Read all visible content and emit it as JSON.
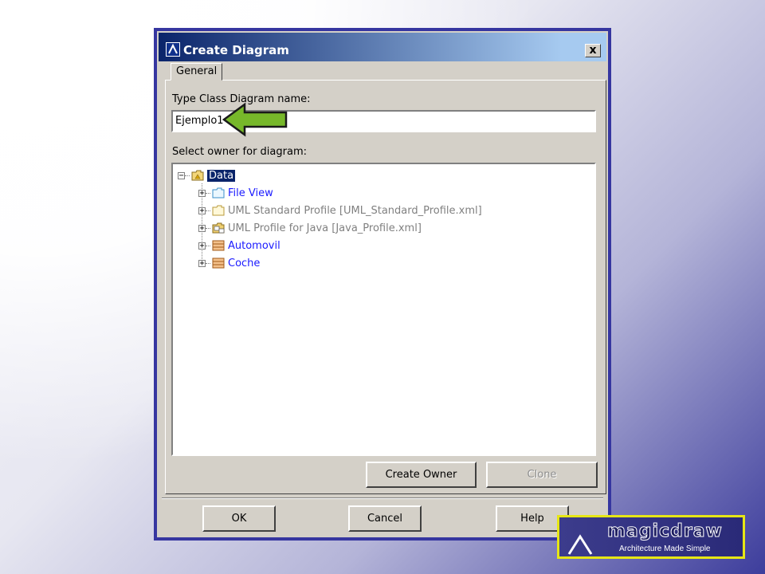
{
  "dialog": {
    "title": "Create Diagram",
    "close_glyph": "x"
  },
  "tabs": [
    {
      "label": "General",
      "active": true
    }
  ],
  "name_field": {
    "label": "Type Class Diagram name:",
    "value": "Ejemplo1"
  },
  "owner": {
    "label": "Select owner for diagram:",
    "tree": [
      {
        "label": "Data",
        "icon": "package-icon",
        "expander": "−",
        "selected": true,
        "color": "#000000"
      },
      {
        "label": "File View",
        "icon": "folder-icon",
        "expander": "+",
        "color": "#1a1aff"
      },
      {
        "label": "UML Standard Profile [UML_Standard_Profile.xml]",
        "icon": "folder-icon",
        "expander": "+",
        "color": "#808080"
      },
      {
        "label": "UML Profile for Java [Java_Profile.xml]",
        "icon": "profile-icon",
        "expander": "+",
        "color": "#808080"
      },
      {
        "label": "Automovil",
        "icon": "class-icon",
        "expander": "+",
        "color": "#1a1aff"
      },
      {
        "label": "Coche",
        "icon": "class-icon",
        "expander": "+",
        "color": "#1a1aff"
      }
    ]
  },
  "buttons": {
    "create_owner": "Create Owner",
    "clone": "Clone",
    "ok": "OK",
    "cancel": "Cancel",
    "help": "Help"
  },
  "logo": {
    "wordmark": "magicdraw",
    "tagline": "Architecture Made Simple"
  },
  "colors": {
    "dialog_border": "#3636a0",
    "selection": "#0a246a",
    "arrow_fill": "#77b82a",
    "logo_border": "#e6e615"
  }
}
